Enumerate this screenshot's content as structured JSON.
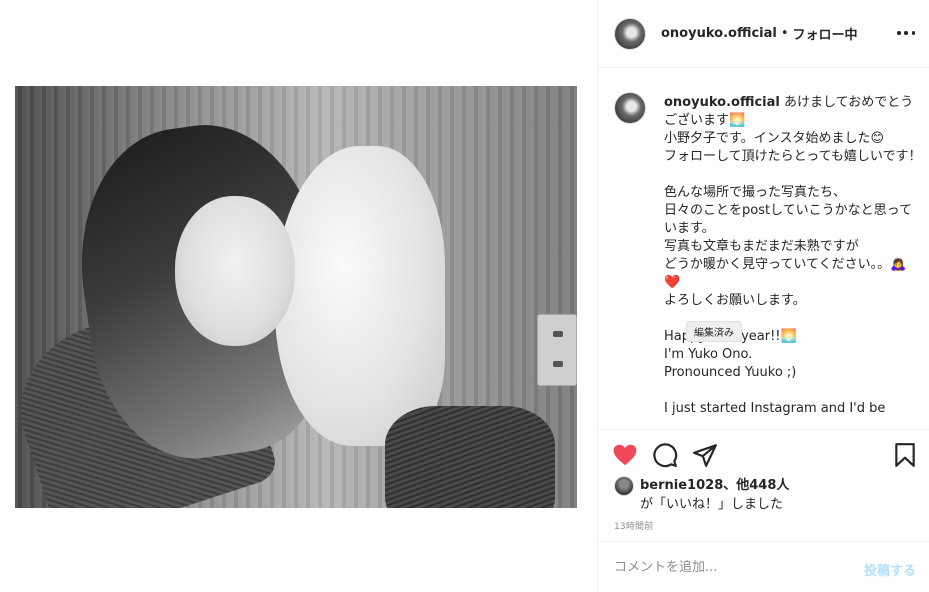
{
  "post": {
    "username": "onoyuko.official",
    "separator": "•",
    "follow_status": "フォロー中"
  },
  "caption": {
    "username": "onoyuko.official",
    "body": " あけましておめでとうございます🌅\n小野夕子です。インスタ始めました😊\nフォローして頂けたらとっても嬉しいです！\n\n色んな場所で撮った写真たち、\n日々のことをpostしていこうかなと思っています。\n写真も文章もまだまだ未熟ですが\nどうか暖かく見守っていてください。。🙇‍♀️\n❤️\nよろしくお願いします。\n\nHappy new year!!🌅\nI'm Yuko Ono.\nPronounced Yuuko ;)\n\nI just started Instagram and I'd be",
    "tooltip": "編集済み"
  },
  "likes": {
    "first_user": "bernie1028",
    "others": "、他448人",
    "suffix": "が「いいね！」しました"
  },
  "timestamp": "13時間前",
  "comment": {
    "placeholder": "コメントを追加...",
    "post_label": "投稿する"
  },
  "colors": {
    "like_red": "#ed4956",
    "post_button_disabled": "#b2dffc",
    "text": "#262626",
    "muted": "#8e8e8e"
  },
  "icons": [
    "heart-filled-icon",
    "comment-icon",
    "share-icon",
    "bookmark-icon",
    "more-icon"
  ]
}
